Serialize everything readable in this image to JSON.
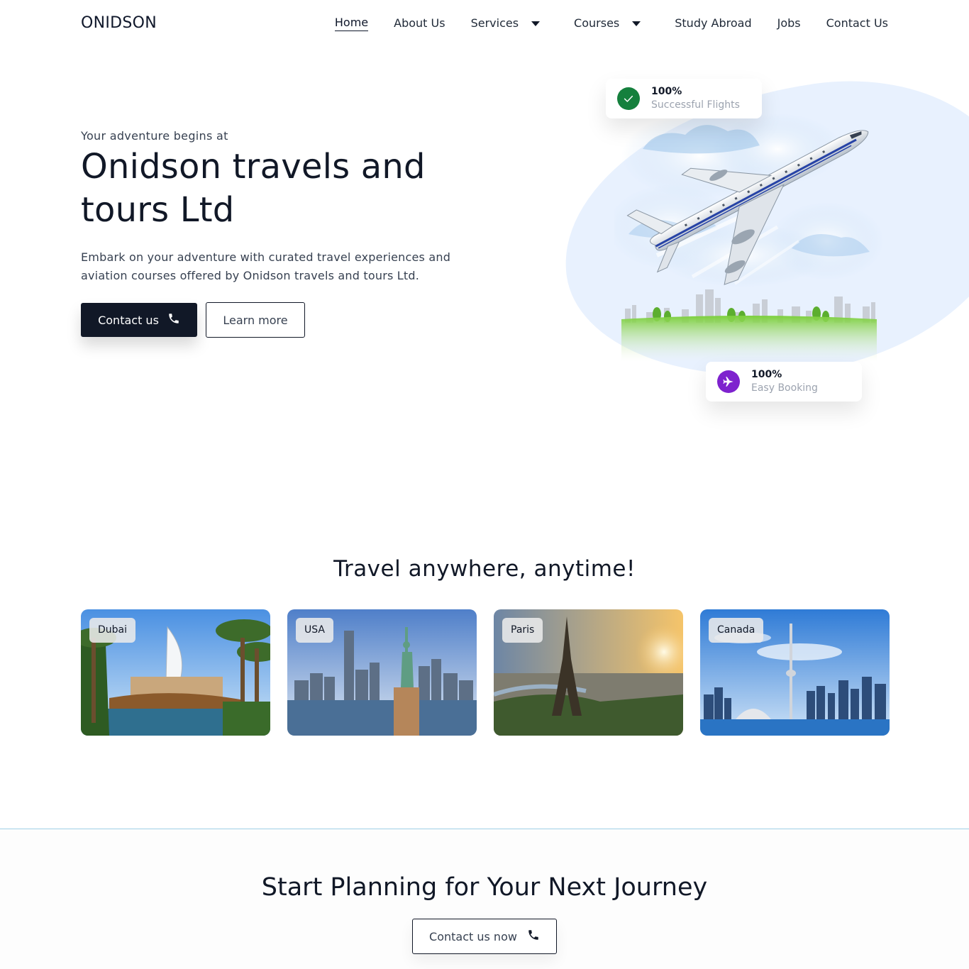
{
  "nav": {
    "logo": "ONIDSON",
    "items": [
      {
        "label": "Home",
        "active": true
      },
      {
        "label": "About Us"
      },
      {
        "label": "Services",
        "dropdown": true
      },
      {
        "label": "Courses",
        "dropdown": true
      },
      {
        "label": "Study Abroad"
      },
      {
        "label": "Jobs"
      },
      {
        "label": "Contact Us"
      }
    ]
  },
  "hero": {
    "kicker": "Your adventure begins at",
    "title": "Onidson travels and tours Ltd",
    "description": "Embark on your adventure with curated travel experiences and aviation courses offered by Onidson travels and tours Ltd.",
    "contact_button": "Contact us",
    "learn_button": "Learn more",
    "stats": [
      {
        "value": "100%",
        "label": "Successful Flights",
        "icon": "check-icon",
        "color": "#15803d"
      },
      {
        "value": "100%",
        "label": "Easy Booking",
        "icon": "plane-icon",
        "color": "#7e22ce"
      }
    ]
  },
  "destinations": {
    "title": "Travel anywhere, anytime!",
    "cards": [
      {
        "label": "Dubai"
      },
      {
        "label": "USA"
      },
      {
        "label": "Paris"
      },
      {
        "label": "Canada"
      }
    ]
  },
  "cta": {
    "title": "Start Planning for Your Next Journey",
    "button": "Contact us now"
  },
  "colors": {
    "primary": "#111827",
    "blob": "#e8f1fe",
    "divider": "#9fd0e6"
  }
}
